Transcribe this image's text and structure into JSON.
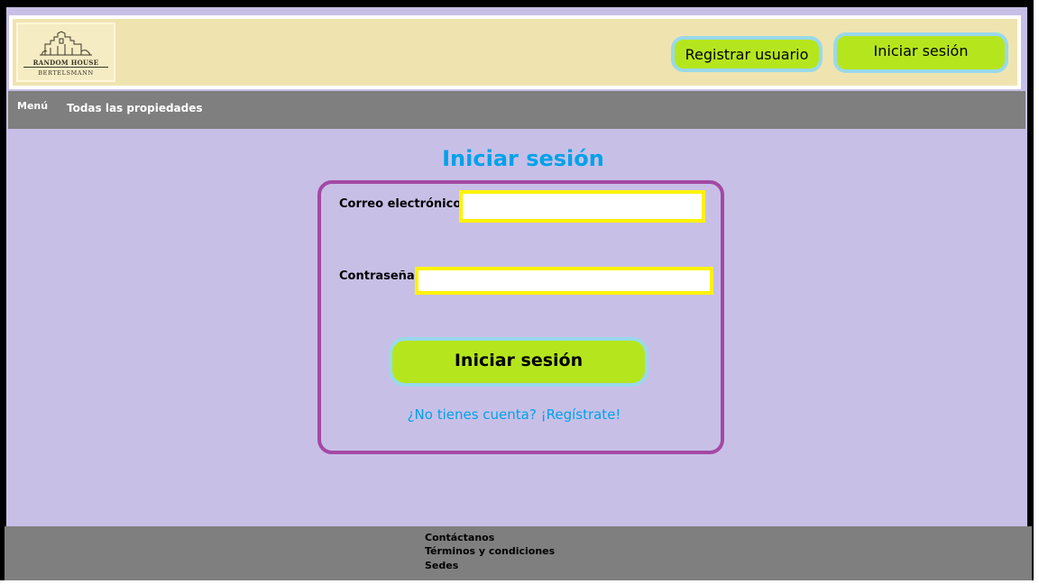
{
  "header": {
    "logo": {
      "line1": "RANDOM HOUSE",
      "line2": "BERTELSMANN"
    },
    "register_label": "Registrar usuario",
    "login_label": "Iniciar sesión"
  },
  "nav": {
    "menu_label": "Menú",
    "all_properties_label": "Todas las propiedades"
  },
  "login_form": {
    "title": "Iniciar sesión",
    "email_label": "Correo electrónico:",
    "email_value": "",
    "password_label": "Contraseña:",
    "password_value": "",
    "submit_label": "Iniciar sesión",
    "register_prompt": "¿No tienes cuenta? ¡Regístrate!"
  },
  "footer": {
    "links": [
      "Contáctanos",
      "Términos y condiciones",
      "Sedes"
    ]
  },
  "colors": {
    "page_bg": "#c8bfe7",
    "header_bg": "#efe4b0",
    "nav_bg": "#7f7f7f",
    "button_bg": "#b5e61d",
    "button_border": "#99d9ea",
    "title_color": "#00a2e8",
    "card_border": "#a349a4",
    "field_border": "#fff200"
  },
  "icons": {
    "logo": "castle-logo-icon"
  }
}
